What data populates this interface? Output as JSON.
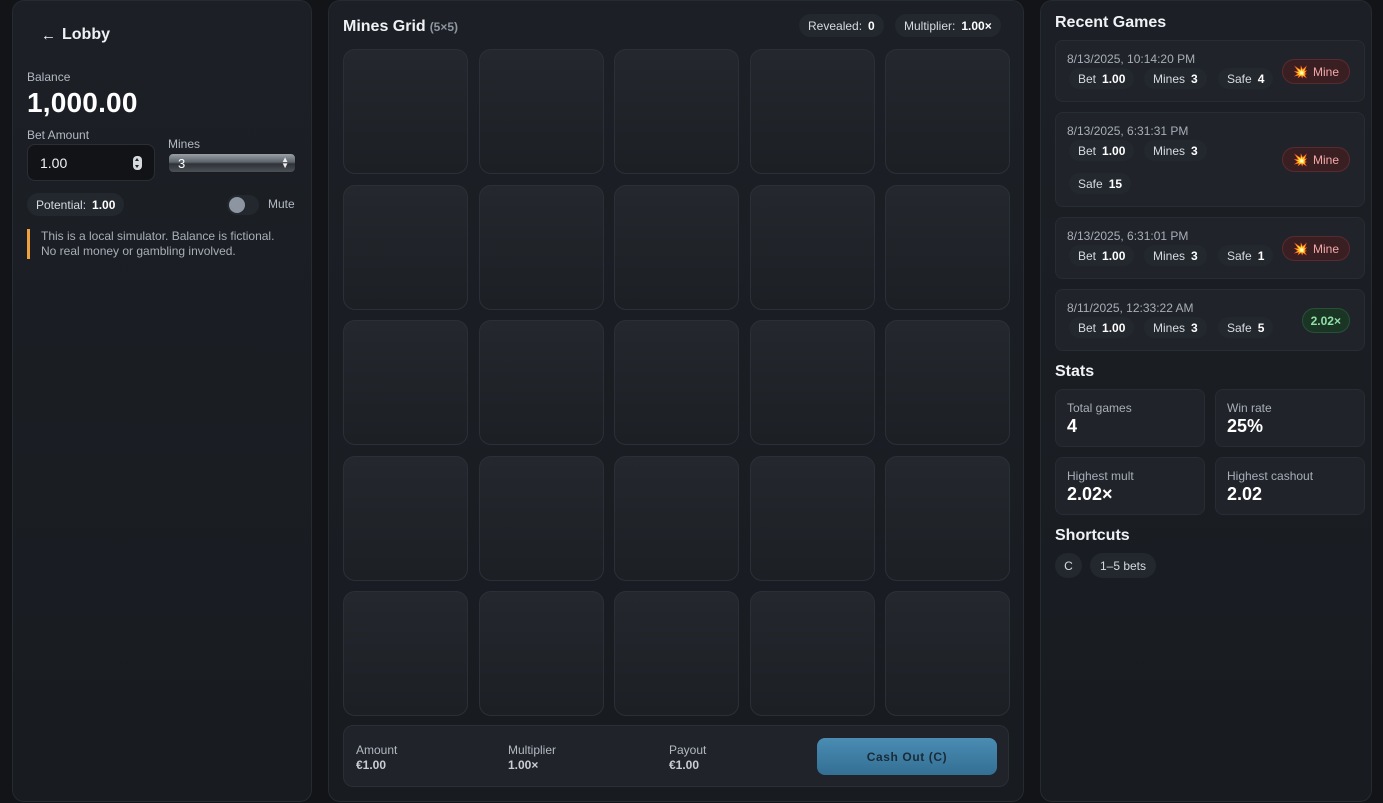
{
  "left": {
    "lobby_label": "Lobby",
    "balance_label": "Balance",
    "balance_value": "1,000.00",
    "bet_amount_label": "Bet Amount",
    "bet_amount_value": "1.00",
    "mines_label": "Mines",
    "mines_value": "3",
    "potential_label": "Potential:",
    "potential_value": "1.00",
    "mute_label": "Mute",
    "notice_line1": "This is a local simulator. Balance is fictional.",
    "notice_line2": "No real money or gambling involved."
  },
  "center": {
    "title": "Mines Grid",
    "size_label": "(5×5)",
    "revealed_label": "Revealed:",
    "revealed_value": "0",
    "multiplier_label": "Multiplier:",
    "multiplier_value": "1.00×",
    "footer": {
      "amount_label": "Amount",
      "amount_value": "€1.00",
      "multiplier_label": "Multiplier",
      "multiplier_value": "1.00×",
      "payout_label": "Payout",
      "payout_value": "€1.00",
      "cashout_label": "Cash Out (C)"
    }
  },
  "right": {
    "recent_title": "Recent Games",
    "games": [
      {
        "date": "8/13/2025, 10:14:20 PM",
        "bet_label": "Bet",
        "bet": "1.00",
        "mines_label": "Mines",
        "mines": "3",
        "safe_label": "Safe",
        "safe": "4",
        "result": "Mine",
        "result_icon": "explosion-icon"
      },
      {
        "date": "8/13/2025, 6:31:31 PM",
        "bet_label": "Bet",
        "bet": "1.00",
        "mines_label": "Mines",
        "mines": "3",
        "safe_label": "Safe",
        "safe": "15",
        "result": "Mine",
        "result_icon": "explosion-icon"
      },
      {
        "date": "8/13/2025, 6:31:01 PM",
        "bet_label": "Bet",
        "bet": "1.00",
        "mines_label": "Mines",
        "mines": "3",
        "safe_label": "Safe",
        "safe": "1",
        "result": "Mine",
        "result_icon": "explosion-icon"
      },
      {
        "date": "8/11/2025, 12:33:22 AM",
        "bet_label": "Bet",
        "bet": "1.00",
        "mines_label": "Mines",
        "mines": "3",
        "safe_label": "Safe",
        "safe": "5",
        "result": "2.02×"
      }
    ],
    "stats_title": "Stats",
    "stats": {
      "total_games_label": "Total games",
      "total_games": "4",
      "win_rate_label": "Win rate",
      "win_rate": "25%",
      "highest_mult_label": "Highest mult",
      "highest_mult": "2.02×",
      "highest_cashout_label": "Highest cashout",
      "highest_cashout": "2.02"
    },
    "shortcuts_title": "Shortcuts",
    "shortcuts": [
      "C",
      "1–5 bets"
    ]
  },
  "colors": {
    "accent": "#3f7fa6",
    "warning": "#f0a13c",
    "mine_red": "#f4a9a9",
    "win_green": "#8fe0a8"
  }
}
